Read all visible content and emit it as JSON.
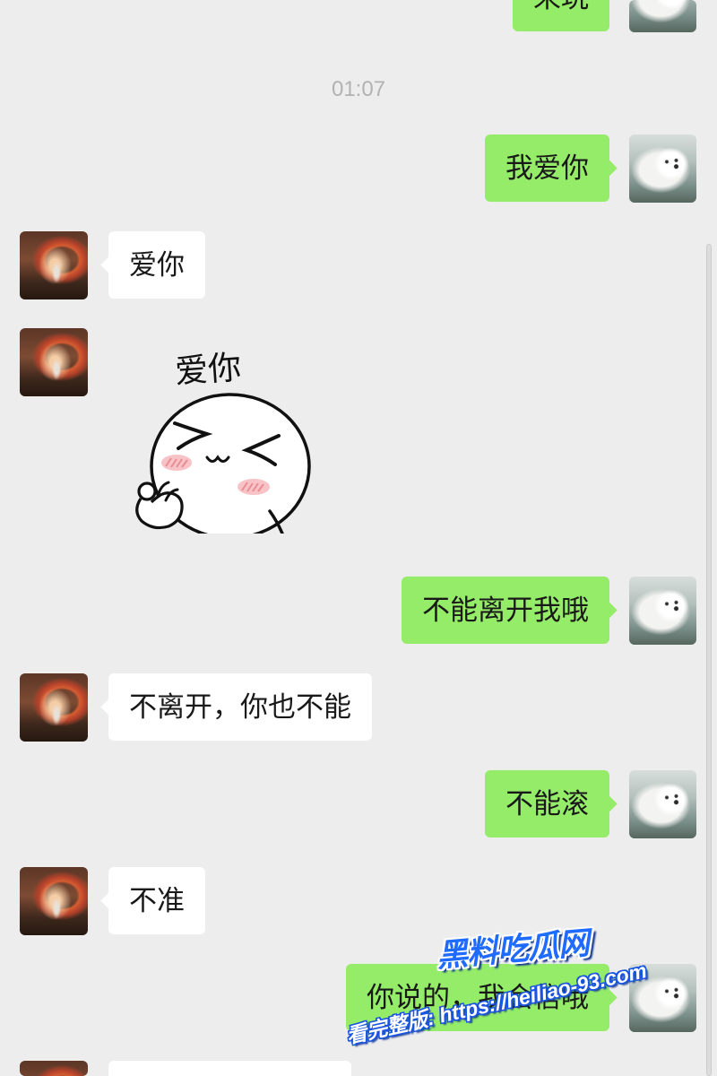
{
  "time_divider": {
    "text": "01:07"
  },
  "avatars": {
    "self_icon": "samoyed-photo-avatar",
    "contact_icon": "arched-corridor-photo-avatar"
  },
  "messages": [
    {
      "outgoing": true,
      "text": "来玩"
    },
    {
      "outgoing": true,
      "text": "我爱你"
    },
    {
      "outgoing": false,
      "text": "爱你"
    },
    {
      "outgoing": false,
      "sticker": {
        "caption": "爱你",
        "icon": "love-you-face-sticker"
      }
    },
    {
      "outgoing": true,
      "text": "不能离开我哦"
    },
    {
      "outgoing": false,
      "text": "不离开，你也不能"
    },
    {
      "outgoing": true,
      "text": "不能滚"
    },
    {
      "outgoing": false,
      "text": "不准"
    },
    {
      "outgoing": true,
      "text": "你说的，我会信哦"
    },
    {
      "outgoing": false,
      "text": ""
    }
  ],
  "watermark": {
    "brand": "黑料吃瓜网",
    "promo": "看完整版: https://heiliao-93.com"
  },
  "colors": {
    "chat_background": "#ededed",
    "sent_bubble": "#95ec69",
    "received_bubble": "#ffffff",
    "message_text": "#191919",
    "time_divider": "#b2b2b2",
    "watermark_blue": "#1f6bff"
  }
}
